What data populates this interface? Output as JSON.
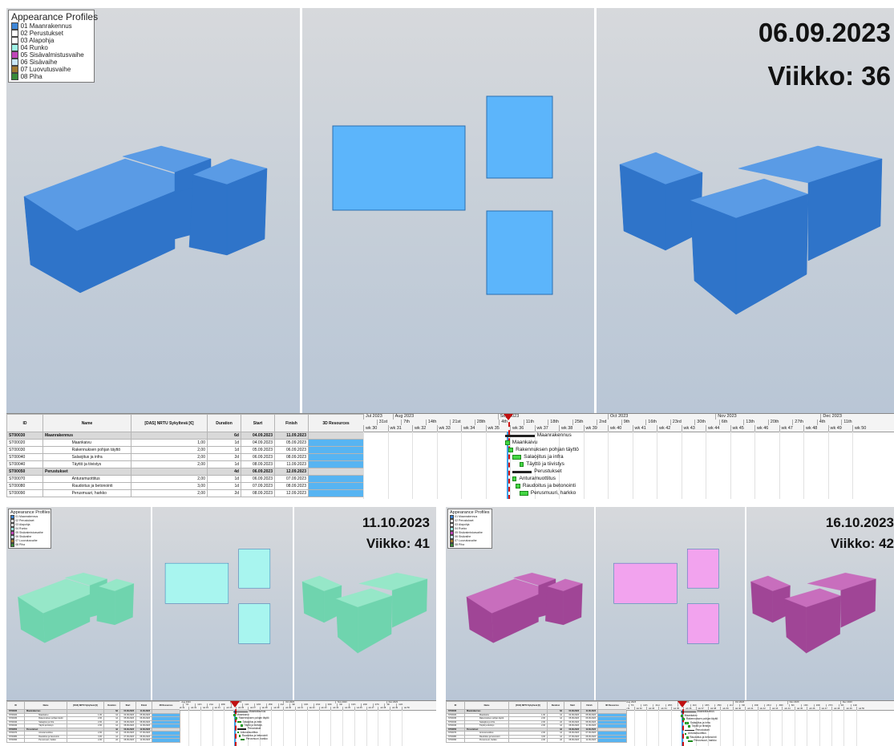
{
  "legend": {
    "title": "Appearance Profiles",
    "items": [
      {
        "label": "01 Maanrakennus",
        "color": "#3d86d8"
      },
      {
        "label": "02 Perustukset",
        "color": "#ffffff"
      },
      {
        "label": "03 Alapohja",
        "color": "#ffffff"
      },
      {
        "label": "04 Runko",
        "color": "#9ff2e6"
      },
      {
        "label": "05 Sisävalmistusvaihe",
        "color": "#c044b8"
      },
      {
        "label": "06 Sisävaihe",
        "color": "#c8e6f8"
      },
      {
        "label": "07 Luovutusvaihe",
        "color": "#a07830"
      },
      {
        "label": "08 Piha",
        "color": "#3a8a3a"
      }
    ]
  },
  "snapshots": [
    {
      "date": "06.09.2023",
      "week": "Viikko: 36",
      "theme": "blue",
      "side": "#2f74c9",
      "top": "#5a9be5",
      "plan": "#5cb5fb",
      "phase": "01 Maanrakennus"
    },
    {
      "date": "11.10.2023",
      "week": "Viikko: 41",
      "theme": "green",
      "side": "#6fd4ae",
      "top": "#96e7c8",
      "plan": "#a8f5ef",
      "phase": "04 Runko"
    },
    {
      "date": "16.10.2023",
      "week": "Viikko: 42",
      "theme": "magenta",
      "side": "#a04596",
      "top": "#c86ebd",
      "plan": "#f2a3ee",
      "phase": "05 Sisävalmistusvaihe"
    }
  ],
  "table": {
    "headers": [
      "ID",
      "Name",
      "[DAS] NRTU Sykyltevä [€]",
      "Duration",
      "Start",
      "Finish",
      "3D Resources"
    ],
    "rows": [
      {
        "id": "ST00030",
        "name": "Maanrakennus",
        "cost": "",
        "dur": "6d",
        "start": "04.09.2023",
        "finish": "11.09.2023",
        "group": true
      },
      {
        "id": "ST00020",
        "name": "Maankaivu",
        "cost": "1,00",
        "dur": "1d",
        "start": "04.09.2023",
        "finish": "05.09.2023",
        "group": false
      },
      {
        "id": "ST00030",
        "name": "Rakennuksen pohjan täyttö",
        "cost": "2,00",
        "dur": "1d",
        "start": "05.09.2023",
        "finish": "06.09.2023",
        "group": false
      },
      {
        "id": "ST00040",
        "name": "Salaojitus ja infra",
        "cost": "2,00",
        "dur": "2d",
        "start": "06.09.2023",
        "finish": "08.09.2023",
        "group": false
      },
      {
        "id": "ST00040",
        "name": "Täyttö ja tiivistys",
        "cost": "2,00",
        "dur": "1d",
        "start": "08.09.2023",
        "finish": "11.09.2023",
        "group": false
      },
      {
        "id": "ST00050",
        "name": "Perustukset",
        "cost": "",
        "dur": "4d",
        "start": "06.09.2023",
        "finish": "12.09.2023",
        "group": true
      },
      {
        "id": "ST00070",
        "name": "Anturamuottitus",
        "cost": "2,00",
        "dur": "1d",
        "start": "06.09.2023",
        "finish": "07.09.2023",
        "group": false
      },
      {
        "id": "ST00080",
        "name": "Raudoitus ja betonointi",
        "cost": "3,00",
        "dur": "1d",
        "start": "07.09.2023",
        "finish": "08.09.2023",
        "group": false
      },
      {
        "id": "ST00090",
        "name": "Perusmuuri, harkko",
        "cost": "2,00",
        "dur": "2d",
        "start": "08.09.2023",
        "finish": "12.09.2023",
        "group": false
      }
    ]
  },
  "gantt": {
    "months": [
      "Jul 2023",
      "Aug 2023",
      "Sep 2023",
      "Oct 2023",
      "Nov 2023",
      "Dec 2023"
    ],
    "days": [
      "31st",
      "7th",
      "14th",
      "21st",
      "28th",
      "4th",
      "11th",
      "18th",
      "25th",
      "2nd",
      "9th",
      "16th",
      "23rd",
      "30th",
      "6th",
      "13th",
      "20th",
      "27th",
      "4th",
      "11th"
    ],
    "weeks": [
      "wk 30",
      "wk 31",
      "wk 32",
      "wk 33",
      "wk 34",
      "wk 35",
      "wk 36",
      "wk 37",
      "wk 38",
      "wk 39",
      "wk 40",
      "wk 41",
      "wk 42",
      "wk 43",
      "wk 44",
      "wk 45",
      "wk 46",
      "wk 47",
      "wk 48",
      "wk 49",
      "wk 50"
    ],
    "bar_labels": [
      "Maanrakennus",
      "Maankaivu",
      "Rakennuksen pohjan täyttö",
      "Salaojitus ja infra",
      "Täyttö ja tiivistys",
      "Perustukset",
      "Anturamuottitus",
      "Raudoitus ja betonointi",
      "Perusmuuri, harkko"
    ]
  }
}
